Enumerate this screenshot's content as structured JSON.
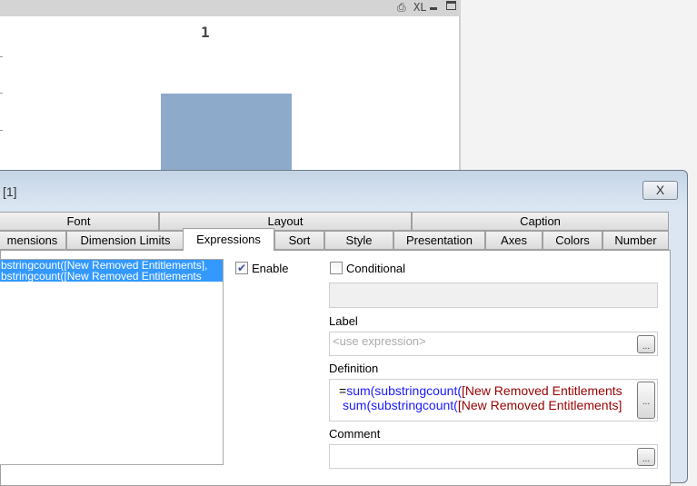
{
  "chart_window": {
    "caption_icons": [
      "print-icon",
      "XL",
      "minimize-icon",
      "maximize-icon"
    ],
    "xl_label": "XL",
    "chart_title": "1"
  },
  "chart_data": {
    "type": "bar",
    "title": "1",
    "categories": [
      ""
    ],
    "values": [
      1
    ],
    "bar_color": "#8eaacb"
  },
  "dialog": {
    "title": "[1]",
    "close_label": "X",
    "tabs_row1": [
      "Font",
      "Layout",
      "Caption"
    ],
    "tabs_row2": [
      "mensions",
      "Dimension Limits",
      "Expressions",
      "Sort",
      "Style",
      "Presentation",
      "Axes",
      "Colors",
      "Number"
    ],
    "active_tab": "Expressions",
    "expressions_list": [
      "bstringcount([New Removed Entitlements],",
      "bstringcount([New Removed Entitlements"
    ],
    "enable_label": "Enable",
    "enable_checked": true,
    "conditional_label": "Conditional",
    "conditional_checked": false,
    "label_heading": "Label",
    "label_placeholder": "<use expression>",
    "definition_heading": "Definition",
    "definition_lines": [
      {
        "prefix": "=",
        "func": "sum(substringcount(",
        "field": "[New Removed Entitlements"
      },
      {
        "prefix": " ",
        "func": "sum(substringcount(",
        "field": "[New Removed Entitlements]"
      }
    ],
    "comment_heading": "Comment",
    "ellipsis": "..."
  }
}
